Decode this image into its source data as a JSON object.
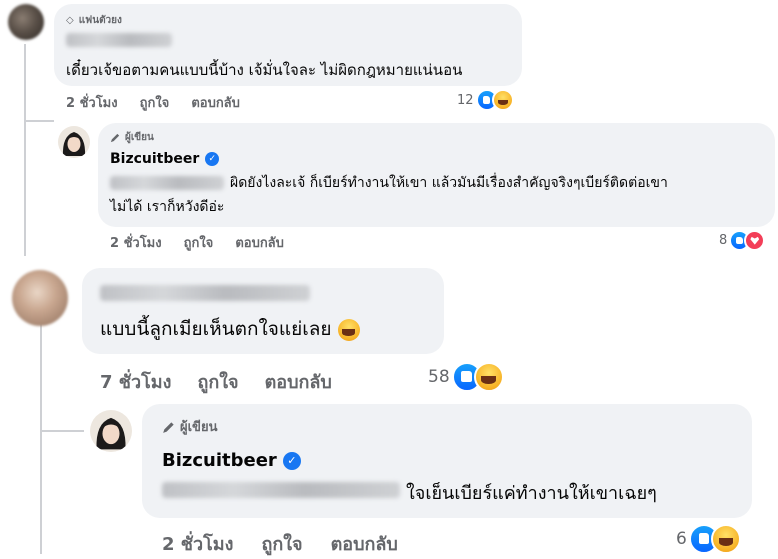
{
  "comments": [
    {
      "badge": "แฟนตัวยง",
      "text": "เดี๋ยวเจ้ขอตามคนแบบนี้บ้าง เจ้มั่นใจละ ไม่ผิดกฎหมายแน่นอน",
      "time": "2 ชั่วโมง",
      "like_label": "ถูกใจ",
      "reply_label": "ตอบกลับ",
      "reaction_count": "12"
    },
    {
      "badge": "ผู้เขียน",
      "name": "Bizcuitbeer",
      "text_line1": "ผิดยังไงละเจ้ ก็เบียร์ทำงานให้เขา แล้วมันมีเรื่องสำคัญจริงๆเบียร์ติดต่อเขา",
      "text_line2": "ไม่ได้ เราก็หวังดีอ่ะ",
      "time": "2 ชั่วโมง",
      "like_label": "ถูกใจ",
      "reply_label": "ตอบกลับ",
      "reaction_count": "8"
    },
    {
      "text": "แบบนี้ลูกเมียเห็นตกใจแย่เลย",
      "time": "7 ชั่วโมง",
      "like_label": "ถูกใจ",
      "reply_label": "ตอบกลับ",
      "reaction_count": "58"
    },
    {
      "badge": "ผู้เขียน",
      "name": "Bizcuitbeer",
      "text": "ใจเย็นเบียร์แค่ทำงานให้เขาเฉยๆ",
      "time": "2 ชั่วโมง",
      "like_label": "ถูกใจ",
      "reply_label": "ตอบกลับ",
      "reaction_count": "6"
    }
  ],
  "icons": {
    "verified": "verified-check-icon",
    "diamond": "diamond-icon",
    "pencil": "pencil-icon",
    "like": "like-reaction-icon",
    "haha": "haha-reaction-icon",
    "love": "love-reaction-icon"
  },
  "colors": {
    "bubble": "#f0f2f5",
    "meta_text": "#65676b",
    "verified": "#1877f2",
    "like": "#0866ff",
    "love": "#f33e58"
  }
}
